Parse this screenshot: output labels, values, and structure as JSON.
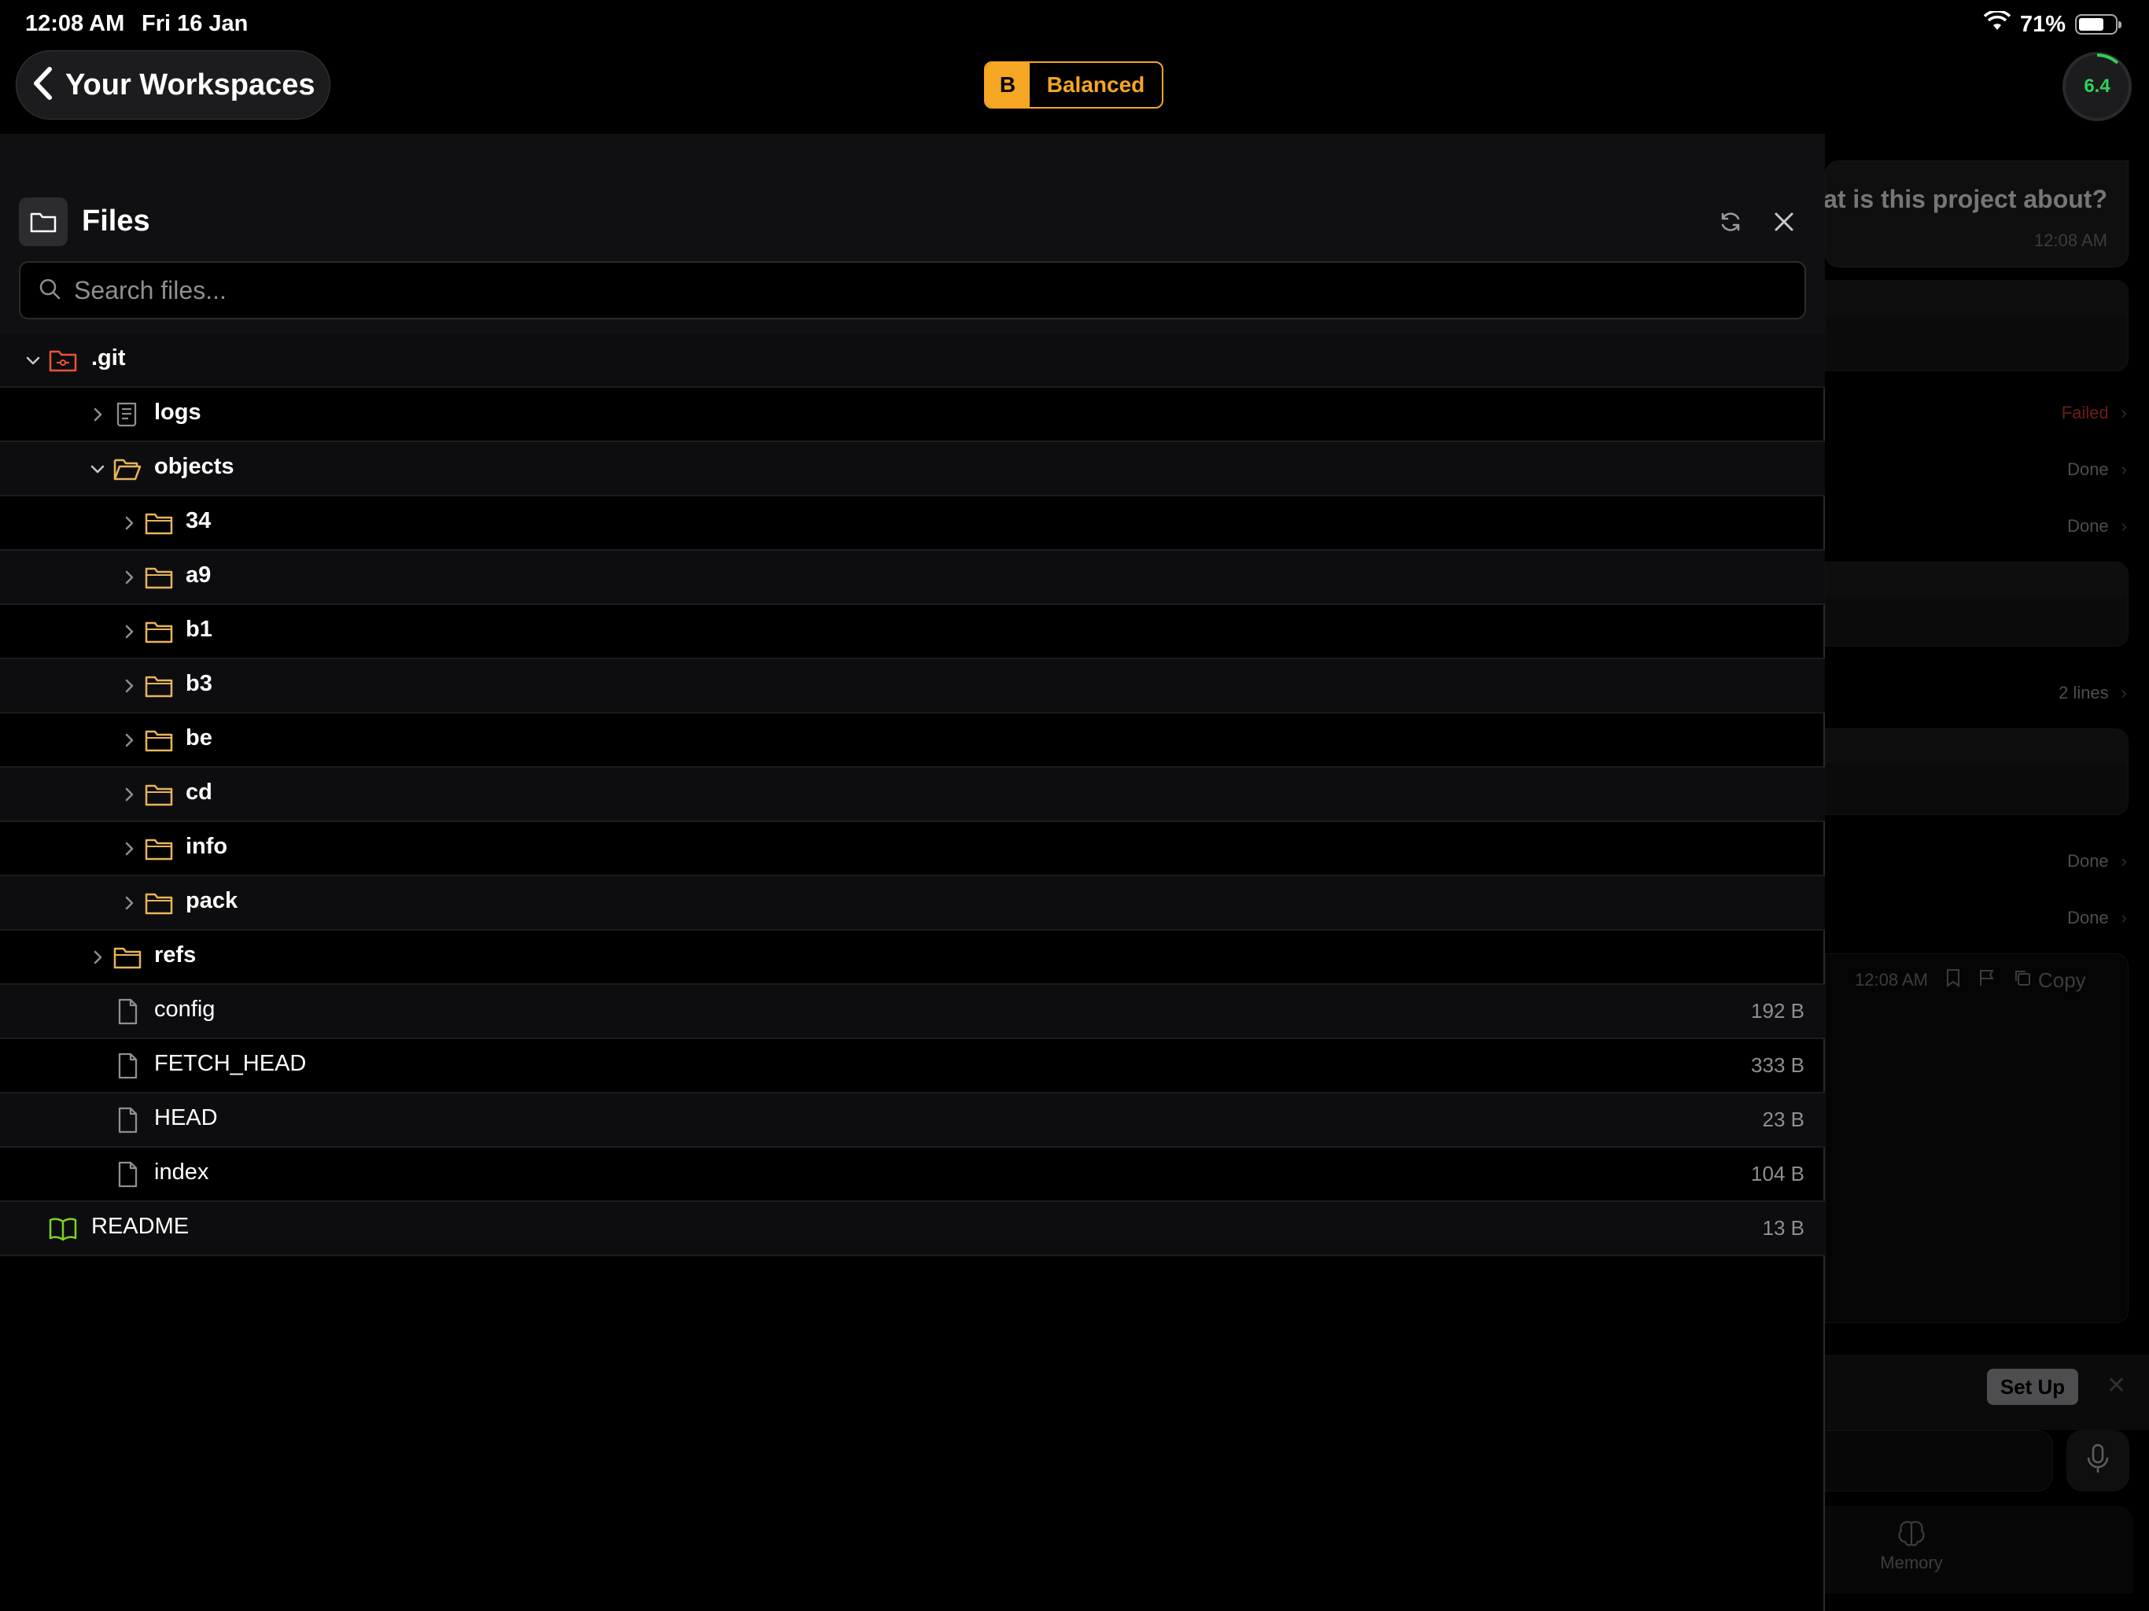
{
  "status_bar": {
    "time": "12:08 AM",
    "date": "Fri 16 Jan",
    "battery": "71%"
  },
  "top_bar": {
    "back_label": "Your Workspaces",
    "mode_letter": "B",
    "mode_label": "Balanced",
    "score": "6.4"
  },
  "colors": {
    "accent": "#f5a623",
    "score": "#30d158",
    "folder": "#e8b45a",
    "git": "#f05133",
    "readme": "#7ed321",
    "failed": "#c0392b"
  },
  "files_panel": {
    "title": "Files",
    "search_placeholder": "Search files...",
    "tree": [
      {
        "name": ".git",
        "depth": 0,
        "type": "git-folder",
        "expanded": true,
        "size": ""
      },
      {
        "name": "logs",
        "depth": 1,
        "type": "log-folder",
        "expanded": false,
        "size": ""
      },
      {
        "name": "objects",
        "depth": 1,
        "type": "folder-open",
        "expanded": true,
        "size": ""
      },
      {
        "name": "34",
        "depth": 2,
        "type": "folder",
        "expanded": false,
        "size": ""
      },
      {
        "name": "a9",
        "depth": 2,
        "type": "folder",
        "expanded": false,
        "size": ""
      },
      {
        "name": "b1",
        "depth": 2,
        "type": "folder",
        "expanded": false,
        "size": ""
      },
      {
        "name": "b3",
        "depth": 2,
        "type": "folder",
        "expanded": false,
        "size": ""
      },
      {
        "name": "be",
        "depth": 2,
        "type": "folder",
        "expanded": false,
        "size": ""
      },
      {
        "name": "cd",
        "depth": 2,
        "type": "folder",
        "expanded": false,
        "size": ""
      },
      {
        "name": "info",
        "depth": 2,
        "type": "folder",
        "expanded": false,
        "size": ""
      },
      {
        "name": "pack",
        "depth": 2,
        "type": "folder",
        "expanded": false,
        "size": ""
      },
      {
        "name": "refs",
        "depth": 1,
        "type": "folder",
        "expanded": false,
        "size": ""
      },
      {
        "name": "config",
        "depth": 1,
        "type": "file",
        "size": "192 B"
      },
      {
        "name": "FETCH_HEAD",
        "depth": 1,
        "type": "file",
        "size": "333 B"
      },
      {
        "name": "HEAD",
        "depth": 1,
        "type": "file",
        "size": "23 B"
      },
      {
        "name": "index",
        "depth": 1,
        "type": "file",
        "size": "104 B"
      },
      {
        "name": "README",
        "depth": 0,
        "type": "readme",
        "size": "13 B"
      }
    ]
  },
  "chat": {
    "question": "hat is this project about?",
    "question_time": "12:08 AM",
    "statuses": [
      "Failed",
      "Done",
      "Done",
      "2 lines",
      "Done",
      "Done"
    ],
    "meta_time": "12:08 AM",
    "copy_label": "Copy",
    "setup_label": "Set Up",
    "memory_label": "Memory"
  }
}
